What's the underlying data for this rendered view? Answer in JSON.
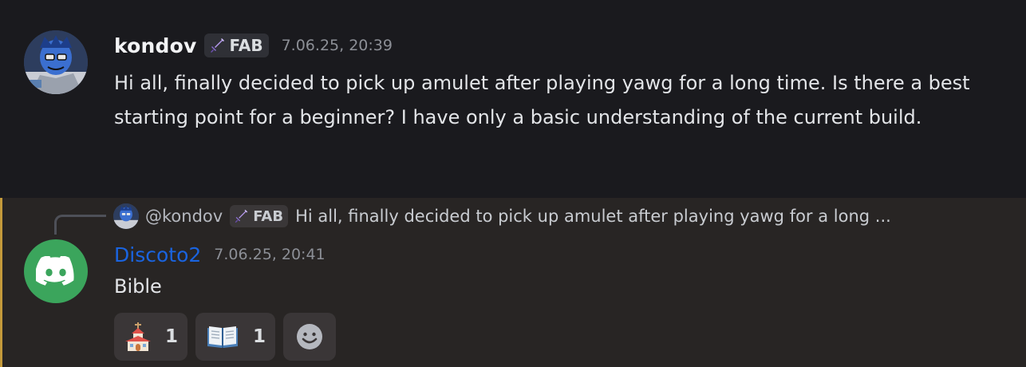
{
  "message1": {
    "author": "kondov",
    "tag": "FAB",
    "timestamp": "7.06.25, 20:39",
    "content": "Hi all, finally decided to pick up amulet after playing yawg for a long time. Is there a best starting point for a beginner? I have only a basic understanding of the current build."
  },
  "message2": {
    "reply": {
      "author": "@kondov",
      "tag": "FAB",
      "preview": "Hi all, finally decided to pick up amulet after playing yawg for a long ..."
    },
    "author": "Discoto2",
    "timestamp": "7.06.25, 20:41",
    "content": "Bible",
    "reactions": [
      {
        "emoji": "church-emoji",
        "count": "1"
      },
      {
        "emoji": "open-book-emoji",
        "count": "1"
      }
    ],
    "author_color": "#1a64e0",
    "avatar_color": "#3ba55c"
  },
  "colors": {
    "mention_bar": "#c49a3b",
    "background": "#1a1a1e",
    "highlight_background": "#282524"
  }
}
